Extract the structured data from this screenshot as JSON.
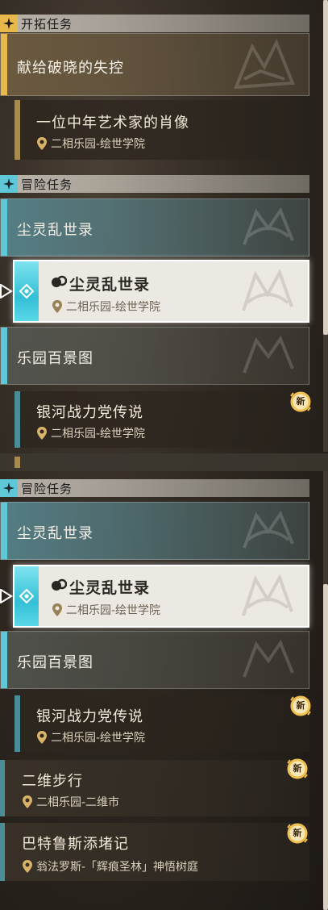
{
  "panel_top": {
    "trailblaze": {
      "section_title": "开拓任务",
      "group_title": "献给破晓的失控",
      "quest": {
        "title": "一位中年艺术家的肖像",
        "location": "二相乐园-绘世学院"
      }
    },
    "adventure": {
      "section_title": "冒险任务",
      "group1_title": "尘灵乱世录",
      "selected_quest": {
        "title": "尘灵乱世录",
        "location": "二相乐园-绘世学院"
      },
      "group2_title": "乐园百景图",
      "quest": {
        "title": "银河战力党传说",
        "location": "二相乐园-绘世学院",
        "badge": "新"
      }
    }
  },
  "panel_bottom": {
    "adventure": {
      "section_title": "冒险任务",
      "group1_title": "尘灵乱世录",
      "selected_quest": {
        "title": "尘灵乱世录",
        "location": "二相乐园-绘世学院"
      },
      "group2_title": "乐园百景图",
      "quest": {
        "title": "银河战力党传说",
        "location": "二相乐园-绘世学院",
        "badge": "新"
      }
    },
    "standalone_quests": [
      {
        "title": "二维步行",
        "location": "二相乐园-二维市",
        "badge": "新"
      },
      {
        "title": "巴特鲁斯添堵记",
        "location": "翁法罗斯-「辉痕圣林」神悟树庭",
        "badge": "新"
      }
    ]
  },
  "colors": {
    "trailblaze_accent": "#e8b84a",
    "adventure_accent": "#5fc8d8",
    "quest_bar_gold": "#a78a4f",
    "quest_bar_teal": "#4a8d99",
    "badge_gold": "#f0c050"
  },
  "icons": [
    "trailblaze-star-icon",
    "adventure-diamond-icon",
    "location-pin-icon",
    "tracking-arrow-icon",
    "new-badge-icon",
    "quest-type-icon"
  ]
}
